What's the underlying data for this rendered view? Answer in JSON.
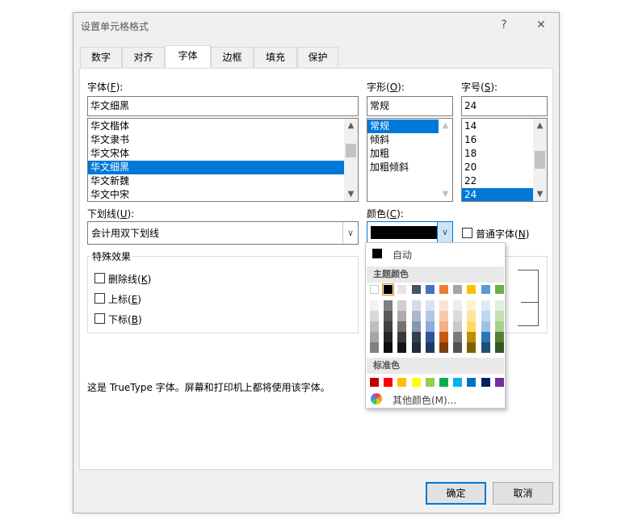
{
  "dialog": {
    "title": "设置单元格格式",
    "help_glyph": "?",
    "close_glyph": "✕"
  },
  "tabs": [
    {
      "label": "数字"
    },
    {
      "label": "对齐"
    },
    {
      "label": "字体",
      "active": true
    },
    {
      "label": "边框"
    },
    {
      "label": "填充"
    },
    {
      "label": "保护"
    }
  ],
  "font": {
    "label": "字体",
    "accel": "F",
    "value": "华文细黑",
    "options": [
      "华文楷体",
      "华文隶书",
      "华文宋体",
      "华文细黑",
      "华文新魏",
      "华文中宋"
    ],
    "selected": "华文细黑"
  },
  "style": {
    "label": "字形",
    "accel": "O",
    "value": "常规",
    "options": [
      "常规",
      "倾斜",
      "加粗",
      "加粗倾斜"
    ],
    "selected": "常规"
  },
  "size": {
    "label": "字号",
    "accel": "S",
    "value": "24",
    "options": [
      "14",
      "16",
      "18",
      "20",
      "22",
      "24"
    ],
    "selected": "24"
  },
  "underline": {
    "label": "下划线",
    "accel": "U",
    "value": "会计用双下划线"
  },
  "color": {
    "label": "颜色",
    "accel": "C",
    "value_hex": "#000000"
  },
  "normal_font": {
    "label": "普通字体",
    "accel": "N",
    "checked": false
  },
  "effects": {
    "title": "特殊效果",
    "items": [
      {
        "label": "删除线",
        "accel": "K",
        "checked": false
      },
      {
        "label": "上标",
        "accel": "E",
        "checked": false
      },
      {
        "label": "下标",
        "accel": "B",
        "checked": false
      }
    ]
  },
  "info_text": "这是 TrueType 字体。屏幕和打印机上都将使用该字体。",
  "buttons": {
    "ok": "确定",
    "cancel": "取消"
  },
  "color_popup": {
    "auto_label": "自动",
    "auto_color": "#000000",
    "theme_title": "主题颜色",
    "theme_top": [
      "#ffffff",
      "#000000",
      "#e7e6e6",
      "#44546a",
      "#4472c4",
      "#ed7d31",
      "#a5a5a5",
      "#ffc000",
      "#5b9bd5",
      "#70ad47"
    ],
    "theme_selected_index": 1,
    "theme_shades": [
      [
        "#f2f2f2",
        "#d9d9d9",
        "#bfbfbf",
        "#a6a6a6",
        "#808080"
      ],
      [
        "#808080",
        "#595959",
        "#404040",
        "#262626",
        "#0d0d0d"
      ],
      [
        "#d0cece",
        "#aeabab",
        "#757171",
        "#3a3838",
        "#171616"
      ],
      [
        "#d6dce4",
        "#adb9ca",
        "#8497b0",
        "#333f4f",
        "#222a35"
      ],
      [
        "#d9e2f3",
        "#b4c6e7",
        "#8eaadb",
        "#2f5496",
        "#1f3864"
      ],
      [
        "#fbe4d5",
        "#f7caac",
        "#f4b083",
        "#c55a11",
        "#833c0b"
      ],
      [
        "#ededed",
        "#dbdbdb",
        "#c9c9c9",
        "#7b7b7b",
        "#525252"
      ],
      [
        "#fff2cc",
        "#fee599",
        "#ffd965",
        "#bf8f00",
        "#7f6000"
      ],
      [
        "#deebf6",
        "#bdd7ee",
        "#9cc3e5",
        "#2e75b5",
        "#1f4e79"
      ],
      [
        "#e2efd9",
        "#c5e0b3",
        "#a8d08d",
        "#538135",
        "#375623"
      ]
    ],
    "standard_title": "标准色",
    "standard": [
      "#c00000",
      "#ff0000",
      "#ffc000",
      "#ffff00",
      "#92d050",
      "#00b050",
      "#00b0f0",
      "#0070c0",
      "#002060",
      "#7030a0"
    ],
    "more_label": "其他颜色(M)..."
  }
}
